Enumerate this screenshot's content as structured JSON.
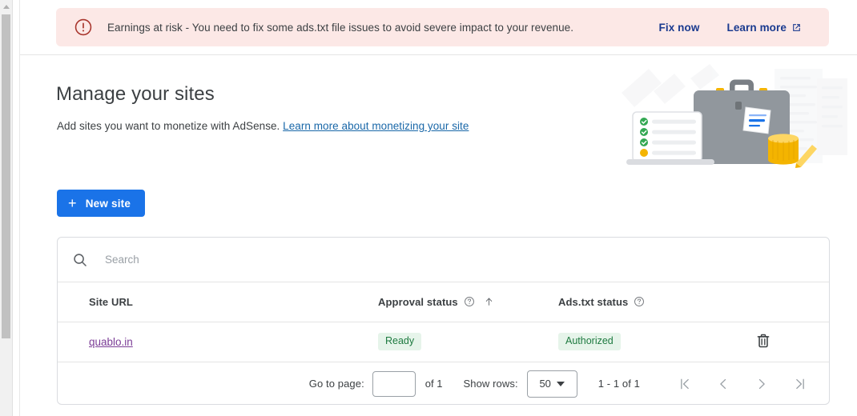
{
  "alert": {
    "icon": "error-circle-icon",
    "message": "Earnings at risk - You need to fix some ads.txt file issues to avoid severe impact to your revenue.",
    "fix_now_label": "Fix now",
    "learn_more_label": "Learn more",
    "external_link_icon": "external-link-icon",
    "background_color": "#fce8e6",
    "accent_color": "#1a3a8f",
    "icon_color": "#b3261e"
  },
  "page": {
    "title": "Manage your sites",
    "subtitle_text": "Add sites you want to monetize with AdSense.",
    "subtitle_link": "Learn more about monetizing your site",
    "link_color": "#1967a8"
  },
  "actions": {
    "new_site_label": "New site",
    "new_site_icon": "plus-icon",
    "new_site_color": "#1a73e8"
  },
  "search": {
    "placeholder": "Search",
    "value": "",
    "icon": "search-icon"
  },
  "table": {
    "columns": [
      {
        "label": "Site URL",
        "help": false,
        "sorted": false
      },
      {
        "label": "Approval status",
        "help": true,
        "sorted": true,
        "sort_direction": "ascending"
      },
      {
        "label": "Ads.txt status",
        "help": true,
        "sorted": false
      },
      {
        "label": "",
        "help": false,
        "sorted": false
      }
    ],
    "rows": [
      {
        "site_url": "quablo.in",
        "approval_status": "Ready",
        "ads_txt_status": "Authorized",
        "delete_icon": "trash-icon"
      }
    ],
    "chip_bg": "#e6f4ea",
    "chip_fg": "#1e7a40",
    "link_color": "#7b3d96"
  },
  "pagination": {
    "goto_page_label": "Go to page:",
    "goto_page_value": "",
    "page_total_label": "of 1",
    "show_rows_label": "Show rows:",
    "rows_per_page": "50",
    "range_label": "1 - 1 of 1",
    "first_page_icon": "first-page-icon",
    "prev_page_icon": "chevron-left-icon",
    "next_page_icon": "chevron-right-icon",
    "last_page_icon": "last-page-icon"
  },
  "illustration": {
    "name": "briefcase-laptop-coins-illustration"
  },
  "scrollbar": {
    "up_arrow_icon": "scroll-up-arrow-icon"
  }
}
